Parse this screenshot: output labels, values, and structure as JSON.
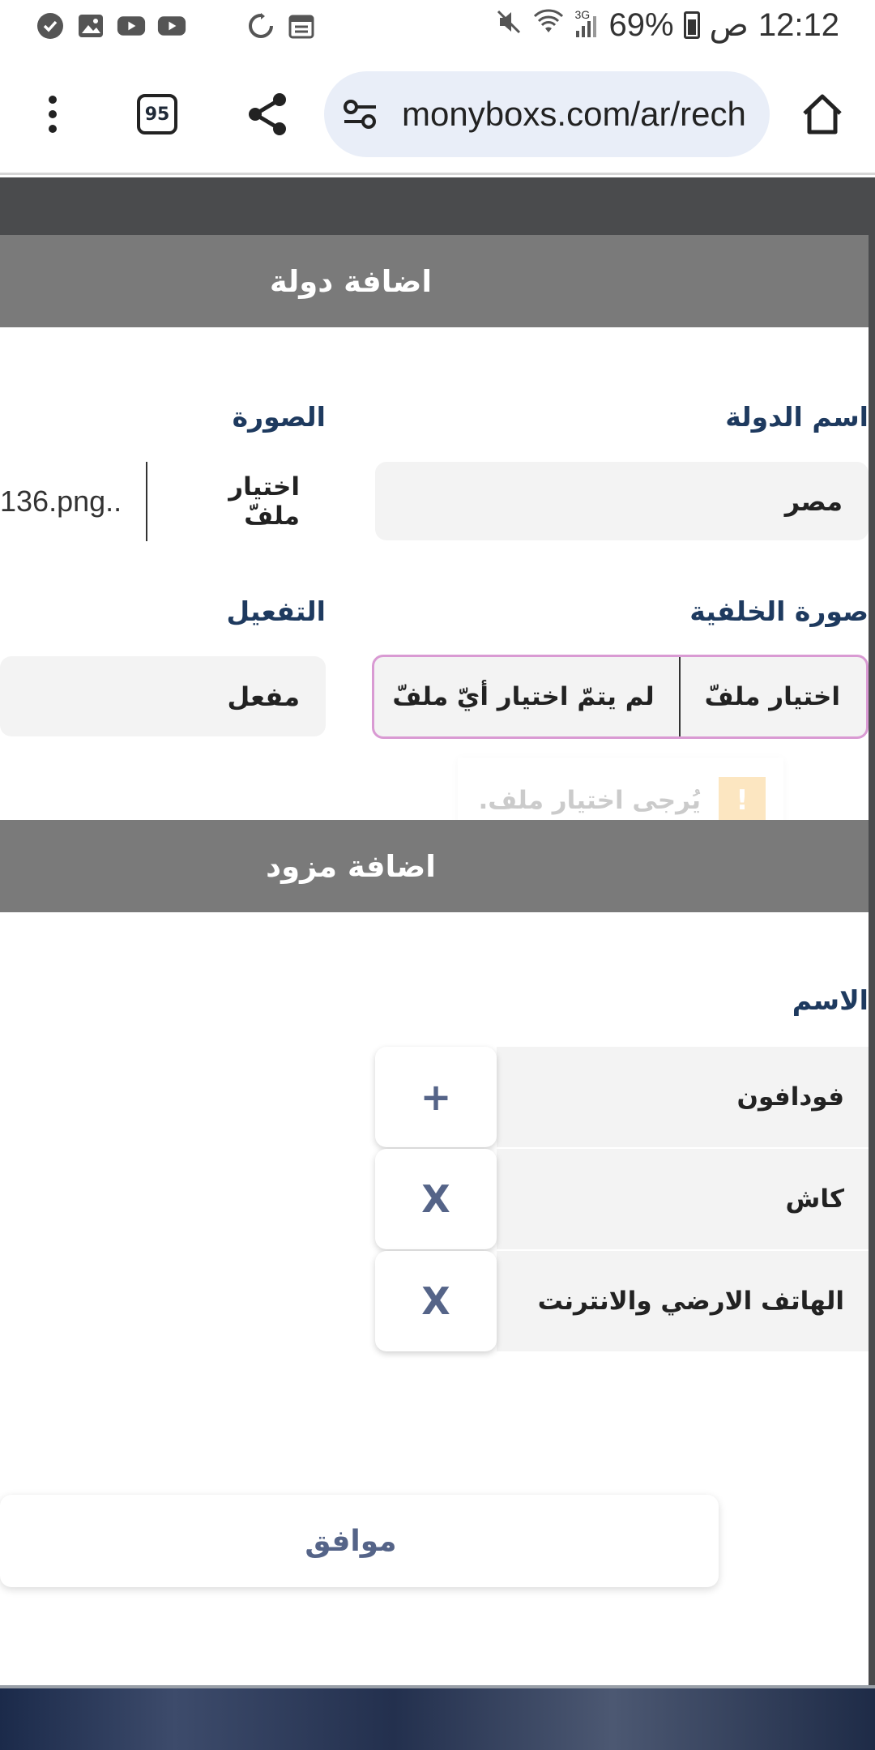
{
  "status_bar": {
    "time": "12:12",
    "am_pm": "ص",
    "battery": "69%",
    "network": "3G"
  },
  "browser": {
    "url": "monyboxs.com/ar/rech",
    "tab_count": "95"
  },
  "add_country": {
    "title": "اضافة دولة",
    "country_name_label": "اسم الدولة",
    "country_name_value": "مصر",
    "image_label": "الصورة",
    "image_choose": "اختيار ملفّ",
    "image_filename": "136.png..",
    "background_label": "صورة الخلفية",
    "background_choose": "اختيار ملفّ",
    "background_status": "لم يتمّ اختيار أيّ ملفّ",
    "activation_label": "التفعيل",
    "activation_value": "مفعل",
    "tooltip": "يُرجى اختيار ملف."
  },
  "add_provider": {
    "title": "اضافة مزود",
    "name_label": "الاسم",
    "providers": [
      {
        "name": "فودافون",
        "action": "+"
      },
      {
        "name": "كاش",
        "action": "X"
      },
      {
        "name": "الهاتف الارضي والانترنت",
        "action": "X"
      }
    ]
  },
  "confirm_button": "موافق"
}
